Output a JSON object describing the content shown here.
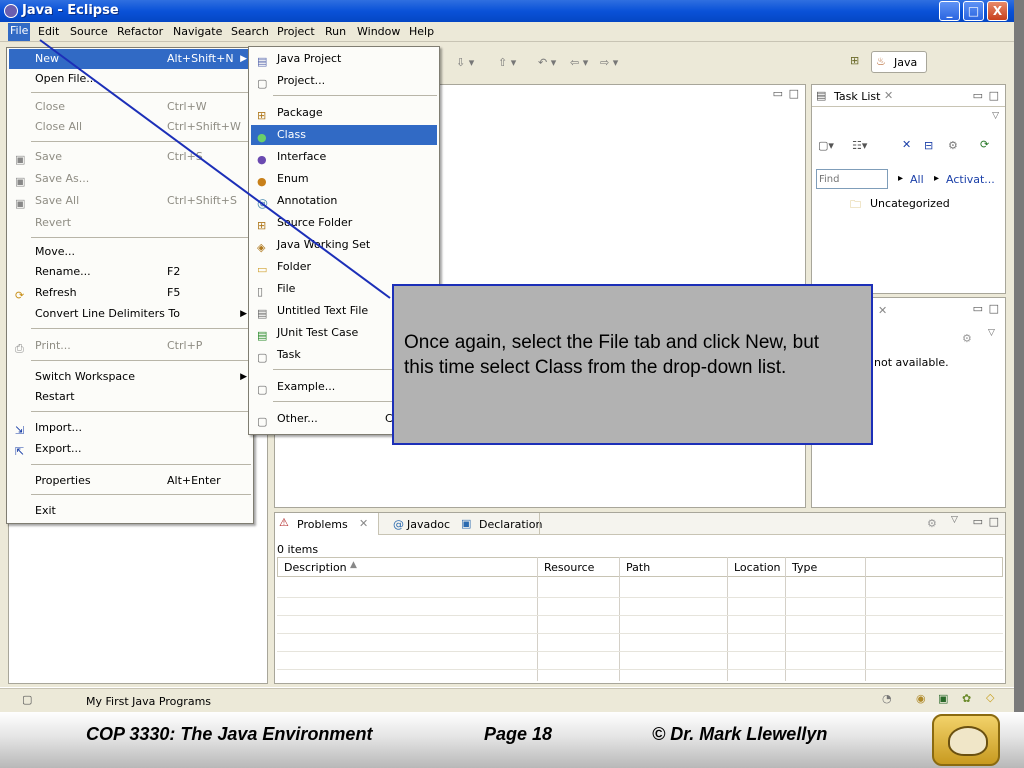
{
  "window": {
    "title": "Java - Eclipse",
    "buttons": [
      "_",
      "□",
      "X"
    ]
  },
  "menubar": {
    "items": [
      "File",
      "Edit",
      "Source",
      "Refactor",
      "Navigate",
      "Search",
      "Project",
      "Run",
      "Window",
      "Help"
    ],
    "active": "File"
  },
  "perspective": {
    "label": "Java"
  },
  "file_menu": {
    "items": [
      {
        "label": "New",
        "accel": "Alt+Shift+N",
        "submenu": true,
        "state": "selected"
      },
      {
        "label": "Open File...",
        "accel": "",
        "state": "enabled"
      },
      {
        "label": "Close",
        "accel": "Ctrl+W",
        "state": "disabled"
      },
      {
        "label": "Close All",
        "accel": "Ctrl+Shift+W",
        "state": "disabled"
      },
      {
        "label": "Save",
        "accel": "Ctrl+S",
        "state": "disabled"
      },
      {
        "label": "Save As...",
        "accel": "",
        "state": "disabled"
      },
      {
        "label": "Save All",
        "accel": "Ctrl+Shift+S",
        "state": "disabled"
      },
      {
        "label": "Revert",
        "accel": "",
        "state": "disabled"
      },
      {
        "label": "Move...",
        "accel": "",
        "state": "enabled"
      },
      {
        "label": "Rename...",
        "accel": "F2",
        "state": "enabled"
      },
      {
        "label": "Refresh",
        "accel": "F5",
        "state": "enabled"
      },
      {
        "label": "Convert Line Delimiters To",
        "accel": "",
        "submenu": true,
        "state": "enabled"
      },
      {
        "label": "Print...",
        "accel": "Ctrl+P",
        "state": "disabled"
      },
      {
        "label": "Switch Workspace",
        "accel": "",
        "submenu": true,
        "state": "enabled"
      },
      {
        "label": "Restart",
        "accel": "",
        "state": "enabled"
      },
      {
        "label": "Import...",
        "accel": "",
        "state": "enabled"
      },
      {
        "label": "Export...",
        "accel": "",
        "state": "enabled"
      },
      {
        "label": "Properties",
        "accel": "Alt+Enter",
        "state": "enabled"
      },
      {
        "label": "Exit",
        "accel": "",
        "state": "enabled"
      }
    ]
  },
  "new_submenu": {
    "items": [
      {
        "label": "Java Project",
        "icon": "java-project-icon"
      },
      {
        "label": "Project...",
        "icon": "project-icon"
      },
      {
        "label": "Package",
        "icon": "package-icon"
      },
      {
        "label": "Class",
        "icon": "class-icon",
        "state": "selected"
      },
      {
        "label": "Interface",
        "icon": "interface-icon"
      },
      {
        "label": "Enum",
        "icon": "enum-icon"
      },
      {
        "label": "Annotation",
        "icon": "annotation-icon"
      },
      {
        "label": "Source Folder",
        "icon": "source-folder-icon"
      },
      {
        "label": "Java Working Set",
        "icon": "working-set-icon"
      },
      {
        "label": "Folder",
        "icon": "folder-icon"
      },
      {
        "label": "File",
        "icon": "file-icon"
      },
      {
        "label": "Untitled Text File",
        "icon": "text-file-icon"
      },
      {
        "label": "JUnit Test Case",
        "icon": "junit-icon"
      },
      {
        "label": "Task",
        "icon": "task-icon"
      },
      {
        "label": "Example...",
        "icon": "example-icon"
      },
      {
        "label": "Other...",
        "accel": "C",
        "icon": "other-icon"
      }
    ]
  },
  "task_list": {
    "tab": "Task List",
    "find_placeholder": "Find",
    "filter_all": "All",
    "filter_activate": "Activat...",
    "category": "Uncategorized"
  },
  "outline": {
    "message": "not available."
  },
  "problems": {
    "tabs": [
      "Problems",
      "Javadoc",
      "Declaration"
    ],
    "count": "0 items",
    "columns": [
      "Description",
      "Resource",
      "Path",
      "Location",
      "Type"
    ]
  },
  "status": {
    "project": "My First Java Programs"
  },
  "callout": {
    "text": "Once again, select the File tab and click New, but this time select Class from the drop-down list."
  },
  "footer": {
    "course": "COP 3330:  The Java Environment",
    "page": "Page 18",
    "author": "© Dr. Mark Llewellyn"
  },
  "colors": {
    "selection": "#316ac5",
    "callout_bg": "#b2b2b2",
    "callout_border": "#1c2fb8",
    "titlebar": "#0a52d8"
  }
}
